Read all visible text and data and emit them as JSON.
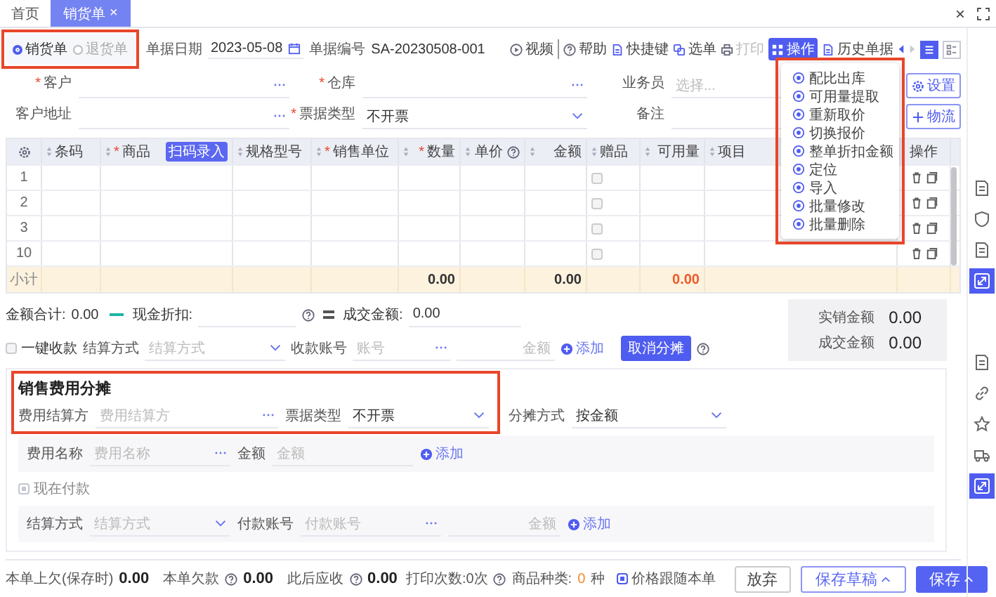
{
  "tabs": [
    {
      "label": "首页",
      "selected": false
    },
    {
      "label": "销货单",
      "close": "×",
      "selected": true
    }
  ],
  "window_close": "×",
  "header": {
    "highlighted": true,
    "doc_types": [
      {
        "label": "销货单",
        "selected": true
      },
      {
        "label": "退货单",
        "selected": false
      }
    ],
    "date_label": "单据日期",
    "date": "2023-05-08",
    "number_label": "单据编号",
    "number": "SA-20230508-001"
  },
  "toolbar": [
    {
      "label": "视频",
      "kind": "video",
      "disabled": false,
      "selected": false
    },
    {
      "label": "帮助",
      "kind": "help",
      "disabled": false,
      "selected": false
    },
    {
      "label": "快捷键",
      "kind": "shortcut",
      "disabled": false,
      "selected": false
    },
    {
      "label": "选单",
      "kind": "pick",
      "disabled": false,
      "selected": false
    },
    {
      "label": "打印",
      "kind": "print",
      "disabled": true,
      "selected": false
    },
    {
      "label": "操作",
      "kind": "action",
      "disabled": false,
      "selected": true
    },
    {
      "label": "历史单据",
      "kind": "history",
      "disabled": false,
      "selected": false
    }
  ],
  "view_modes": [
    {
      "kind": "list",
      "selected": true
    },
    {
      "kind": "grid",
      "selected": false
    }
  ],
  "menu": {
    "highlighted": true,
    "items": [
      "配比出库",
      "可用量提取",
      "重新取价",
      "切换报价",
      "整单折扣金额",
      "定位",
      "导入",
      "批量修改",
      "批量删除"
    ]
  },
  "form": [
    {
      "label": "客户",
      "required_mark": "*",
      "kind": "lookup"
    },
    {
      "label": "仓库",
      "required_mark": "*",
      "kind": "lookup"
    },
    {
      "label": "业务员",
      "kind": "lookup",
      "placeholder": "选择..."
    },
    {
      "label": "客户地址",
      "kind": "lookup"
    },
    {
      "label": "票据类型",
      "required_mark": "*",
      "kind": "select",
      "value": "不开票"
    },
    {
      "label": "备注",
      "kind": "text"
    }
  ],
  "form_buttons": [
    {
      "label": "设置",
      "kind": "settings"
    },
    {
      "label": "物流",
      "kind": "add"
    }
  ],
  "table": {
    "columns": [
      {
        "kind": "index",
        "subtotal": "小计"
      },
      {
        "kind": "text",
        "label": "条码"
      },
      {
        "kind": "text",
        "label": "商品",
        "required_mark": "*",
        "badge": "扫码录入"
      },
      {
        "kind": "text",
        "label": "规格型号"
      },
      {
        "kind": "text",
        "label": "销售单位",
        "required_mark": "*"
      },
      {
        "kind": "number",
        "label": "数量",
        "required_mark": "*",
        "subtotal": "0.00",
        "alert": false
      },
      {
        "kind": "number",
        "label": "单价",
        "help": true
      },
      {
        "kind": "number",
        "label": "金额",
        "subtotal": "0.00",
        "alert": false
      },
      {
        "kind": "check",
        "label": "赠品"
      },
      {
        "kind": "number",
        "label": "可用量",
        "subtotal": "0.00",
        "alert": true
      },
      {
        "kind": "text",
        "label": "项目"
      },
      {
        "kind": "actions",
        "label": "操作"
      }
    ],
    "rows": [
      {
        "number": "1",
        "gift_checked": false
      },
      {
        "number": "2",
        "gift_checked": false
      },
      {
        "number": "3",
        "gift_checked": false
      },
      {
        "number": "10",
        "gift_checked": false
      }
    ]
  },
  "totals": {
    "sum_label": "金额合计:",
    "sum": "0.00",
    "discount_label": "现金折扣:",
    "deal_label": "成交金额:",
    "deal": "0.00"
  },
  "summary": [
    {
      "label": "实销金额",
      "value": "0.00"
    },
    {
      "label": "成交金额",
      "value": "0.00"
    }
  ],
  "payment": {
    "quick_label": "一键收款",
    "quick_checked": false,
    "method_label": "结算方式",
    "method_placeholder": "结算方式",
    "account_label": "收款账号",
    "account_placeholder": "账号",
    "amount_placeholder": "金额",
    "add": "添加",
    "cancel": "取消分摊"
  },
  "expense": {
    "highlighted": true,
    "title": "销售费用分摊",
    "payer_label": "费用结算方",
    "payer_placeholder": "费用结算方",
    "invoice_label": "票据类型",
    "invoice": "不开票",
    "method_label": "分摊方式",
    "method": "按金额",
    "item_label": "费用名称",
    "item_placeholder": "费用名称",
    "amount_label": "金额",
    "amount_placeholder": "金额",
    "add": "添加",
    "pay_now": {
      "label": "现在付款",
      "checked": true,
      "disabled": true
    },
    "pay_method_label": "结算方式",
    "pay_method_placeholder": "结算方式",
    "pay_account_label": "付款账号",
    "pay_account_placeholder": "付款账号",
    "pay_amount_placeholder": "金额",
    "pay_add": "添加"
  },
  "footer": {
    "stats": [
      {
        "label": "本单上欠(保存时)",
        "value": "0.00"
      },
      {
        "label": "本单欠款",
        "value": "0.00",
        "help": true
      },
      {
        "label": "此后应收",
        "value": "0.00",
        "help": true
      }
    ],
    "print_count": "打印次数:0次",
    "goods_label": "商品种类:",
    "goods_count": "0",
    "goods_unit": "种",
    "follow": {
      "label": "价格跟随本单",
      "checked": true
    },
    "buttons": [
      {
        "label": "放弃",
        "kind": "plain",
        "caret": false
      },
      {
        "label": "保存草稿",
        "kind": "outline",
        "caret": true
      },
      {
        "label": "保存",
        "kind": "primary",
        "caret": true
      }
    ]
  },
  "side_groups": [
    [
      {
        "kind": "document",
        "selected": false
      },
      {
        "kind": "shield",
        "selected": false
      },
      {
        "kind": "document",
        "selected": false
      },
      {
        "kind": "resize",
        "selected": true
      }
    ],
    [
      {
        "kind": "document",
        "selected": false
      },
      {
        "kind": "link",
        "selected": false
      },
      {
        "kind": "star",
        "selected": false
      },
      {
        "kind": "truck",
        "selected": false
      },
      {
        "kind": "resize",
        "selected": true
      }
    ]
  ]
}
